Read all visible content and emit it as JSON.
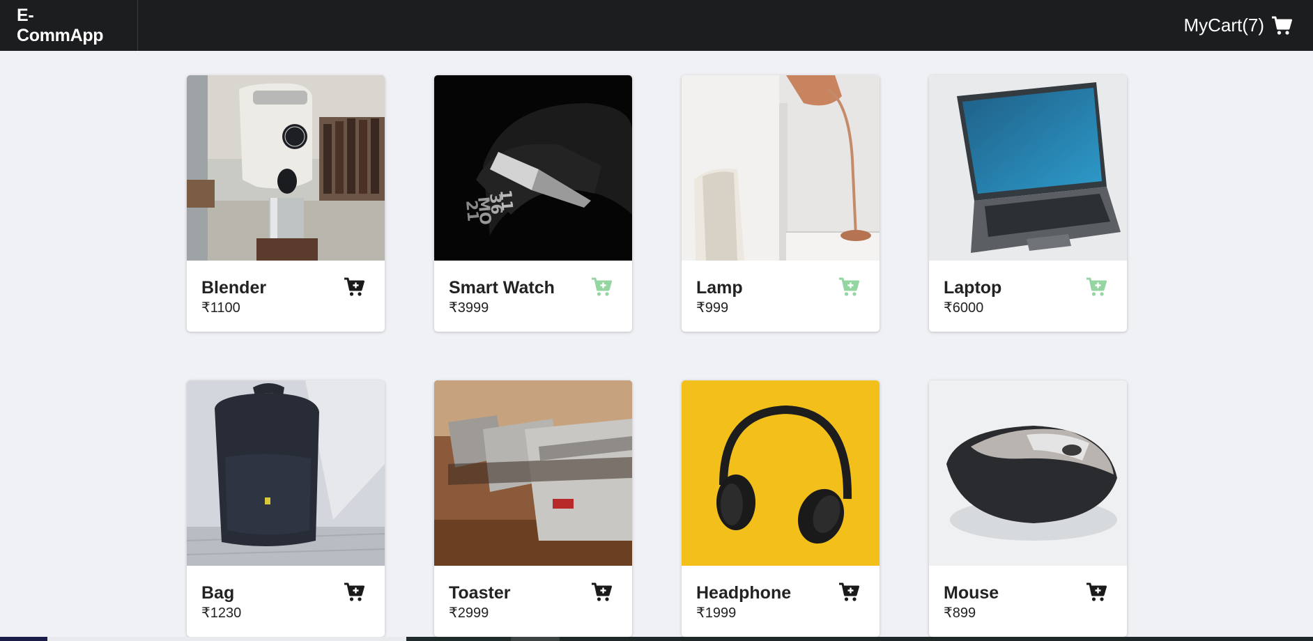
{
  "navbar": {
    "brand": "E-CommApp",
    "cart_label": "MyCart(7)"
  },
  "colors": {
    "navbar_bg": "#1c1d1f",
    "page_bg": "#f0f1f5",
    "in_cart_icon": "#95d5a2",
    "add_icon": "#1a1a1a"
  },
  "products": [
    {
      "name": "Blender",
      "price": "₹1100",
      "in_cart": false,
      "icon": "cart-plus-icon"
    },
    {
      "name": "Smart Watch",
      "price": "₹3999",
      "in_cart": true,
      "icon": "cart-plus-icon"
    },
    {
      "name": "Lamp",
      "price": "₹999",
      "in_cart": true,
      "icon": "cart-plus-icon"
    },
    {
      "name": "Laptop",
      "price": "₹6000",
      "in_cart": true,
      "icon": "cart-plus-icon"
    },
    {
      "name": "Bag",
      "price": "₹1230",
      "in_cart": false,
      "icon": "cart-plus-icon"
    },
    {
      "name": "Toaster",
      "price": "₹2999",
      "in_cart": false,
      "icon": "cart-plus-icon"
    },
    {
      "name": "Headphone",
      "price": "₹1999",
      "in_cart": false,
      "icon": "cart-plus-icon"
    },
    {
      "name": "Mouse",
      "price": "₹899",
      "in_cart": false,
      "icon": "cart-plus-icon"
    }
  ]
}
